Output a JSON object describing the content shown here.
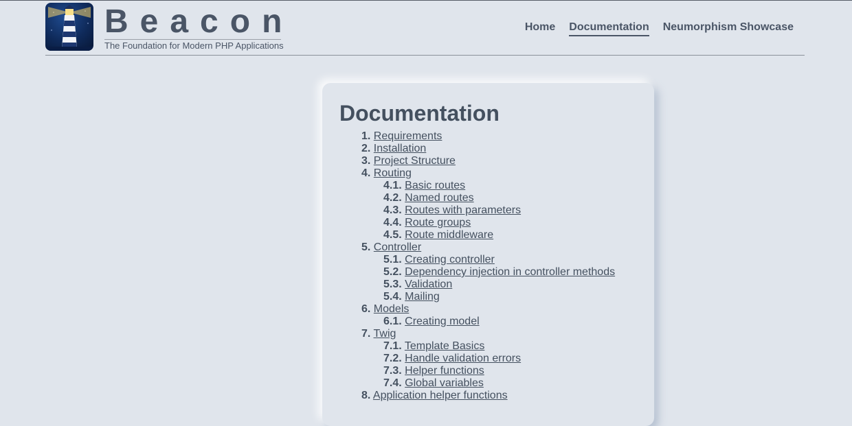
{
  "brand": {
    "title": "Beacon",
    "subtitle": "The Foundation for Modern PHP Applications"
  },
  "nav": {
    "items": [
      {
        "label": "Home"
      },
      {
        "label": "Documentation"
      },
      {
        "label": "Neumorphism Showcase"
      }
    ]
  },
  "page": {
    "heading": "Documentation"
  },
  "toc": [
    {
      "num": "1.",
      "label": "Requirements"
    },
    {
      "num": "2.",
      "label": "Installation"
    },
    {
      "num": "3.",
      "label": "Project Structure"
    },
    {
      "num": "4.",
      "label": "Routing",
      "children": [
        {
          "num": "4.1.",
          "label": "Basic routes"
        },
        {
          "num": "4.2.",
          "label": "Named routes"
        },
        {
          "num": "4.3.",
          "label": "Routes with parameters"
        },
        {
          "num": "4.4.",
          "label": "Route groups"
        },
        {
          "num": "4.5.",
          "label": "Route middleware"
        }
      ]
    },
    {
      "num": "5.",
      "label": "Controller",
      "children": [
        {
          "num": "5.1.",
          "label": "Creating controller"
        },
        {
          "num": "5.2.",
          "label": "Dependency injection in controller methods"
        },
        {
          "num": "5.3.",
          "label": "Validation"
        },
        {
          "num": "5.4.",
          "label": "Mailing"
        }
      ]
    },
    {
      "num": "6.",
      "label": "Models",
      "children": [
        {
          "num": "6.1.",
          "label": "Creating model"
        }
      ]
    },
    {
      "num": "7.",
      "label": "Twig",
      "children": [
        {
          "num": "7.1.",
          "label": "Template Basics"
        },
        {
          "num": "7.2.",
          "label": "Handle validation errors"
        },
        {
          "num": "7.3.",
          "label": "Helper functions"
        },
        {
          "num": "7.4.",
          "label": "Global variables"
        }
      ]
    },
    {
      "num": "8.",
      "label": "Application helper functions"
    }
  ]
}
